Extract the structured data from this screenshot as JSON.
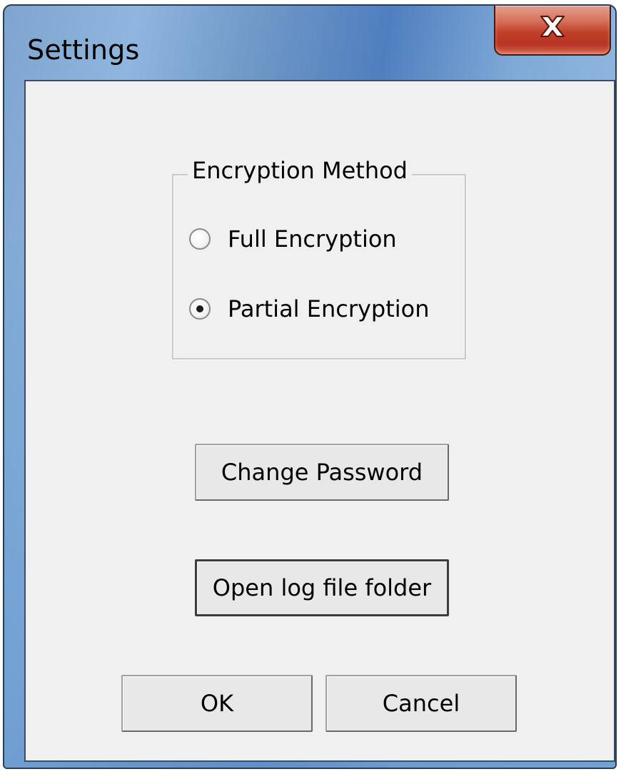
{
  "window": {
    "title": "Settings"
  },
  "encryption_group": {
    "legend": "Encryption Method",
    "options": [
      {
        "label": "Full Encryption",
        "checked": false
      },
      {
        "label": "Partial Encryption",
        "checked": true
      }
    ]
  },
  "buttons": {
    "change_password": "Change Password",
    "open_log_folder": "Open log file folder",
    "ok": "OK",
    "cancel": "Cancel"
  },
  "icons": {
    "close": "close-icon"
  }
}
